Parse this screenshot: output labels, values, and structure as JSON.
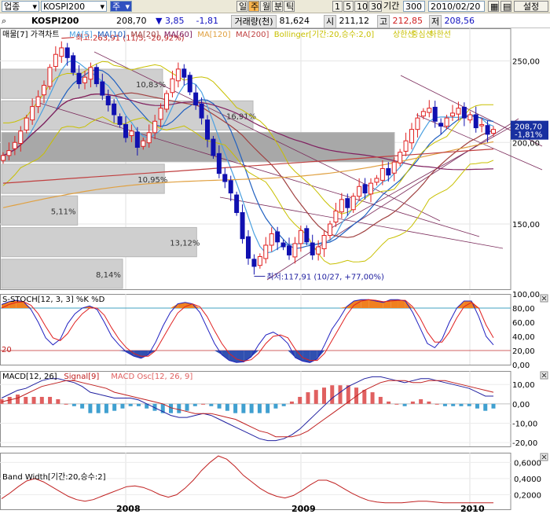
{
  "toolbar": {
    "market_select": "업종",
    "index_select": "KOSPI200",
    "period_select": "주",
    "period_buttons": [
      "일",
      "주",
      "월",
      "분",
      "틱"
    ],
    "num_buttons": [
      "1",
      "5",
      "10",
      "30"
    ],
    "count_label": "기간",
    "count_value": "300",
    "date_value": "2010/02/20",
    "settings_label": "설정"
  },
  "quote": {
    "name": "KOSPI200",
    "price": "208,70",
    "change_arrow": "▼",
    "change": "3,85",
    "change_pct": "-1,81",
    "volume_label": "거래량(천)",
    "volume": "81,624",
    "open_label": "시",
    "open": "211,12",
    "high_label": "고",
    "high": "212,85",
    "low_label": "저",
    "low": "208,56"
  },
  "colors": {
    "up": "#e02020",
    "down": "#1010b0",
    "ma5": "#4aa0e0",
    "ma10": "#2060c0",
    "ma20": "#a04040",
    "ma60": "#802060",
    "ma120": "#e0a040",
    "ma200": "#c04040",
    "bollinger": "#c8c000",
    "stoch_k": "#2020c0",
    "stoch_d": "#e02020",
    "macd": "#2020a0",
    "signal": "#c02020",
    "osc_pos": "#e06060",
    "osc_neg": "#40a0d0",
    "bandwidth": "#c02020",
    "price_tag_bg": "#1830a0"
  },
  "chart_data": [
    {
      "type": "line",
      "title": "매물[7] 가격차트",
      "legend": [
        "MA[5]",
        "MA[10]",
        "MA[20]",
        "MA[60]",
        "MA[120]",
        "MA[200]",
        "Bollinger[기간:20,승수:2,0]",
        "상한선",
        "중심선",
        "하한선"
      ],
      "ylim": [
        110,
        270
      ],
      "yticks": [
        "250,00",
        "200,00",
        "150,00"
      ],
      "ytick_values": [
        250,
        200,
        150
      ],
      "x_labels": [
        "2008",
        "2009",
        "2010"
      ],
      "current_price_tag": [
        "208,70",
        "-1,81%"
      ],
      "max_annotation": "최고:263,91 (11/5, -20,92%)",
      "min_annotation": "최저:117,91 (10/27, +77,00%)",
      "max_value": 263.91,
      "min_value": 117.91,
      "volume_profile": [
        {
          "label": "10,83%",
          "pct": 10.83
        },
        {
          "label": "16,91%",
          "pct": 16.91
        },
        {
          "label": "",
          "pct": 26.42
        },
        {
          "label": "10,95%",
          "pct": 10.95
        },
        {
          "label": "5,11%",
          "pct": 5.11
        },
        {
          "label": "13,12%",
          "pct": 13.12
        },
        {
          "label": "8,14%",
          "pct": 8.14
        }
      ],
      "weekly_close": [
        192,
        195,
        200,
        207,
        215,
        222,
        228,
        235,
        246,
        254,
        258,
        252,
        243,
        236,
        240,
        246,
        236,
        229,
        223,
        217,
        211,
        203,
        207,
        197,
        201,
        206,
        213,
        221,
        230,
        239,
        245,
        240,
        231,
        223,
        215,
        202,
        192,
        181,
        176,
        169,
        157,
        141,
        129,
        124,
        130,
        137,
        144,
        139,
        136,
        131,
        138,
        146,
        139,
        131,
        136,
        143,
        150,
        158,
        165,
        160,
        167,
        173,
        169,
        175,
        178,
        184,
        180,
        188,
        194,
        201,
        208,
        215,
        219,
        221,
        213,
        210,
        215,
        218,
        221,
        215,
        217,
        209,
        211,
        205,
        208
      ]
    },
    {
      "type": "line",
      "title": "S-STOCH[12, 3, 3] %K %D",
      "series": [
        {
          "name": "%K"
        },
        {
          "name": "%D"
        }
      ],
      "ylim": [
        0,
        100
      ],
      "yticks": [
        "100,00",
        "80,00",
        "60,00",
        "40,00",
        "20,00",
        "0,00"
      ],
      "ytick_values": [
        100,
        80,
        60,
        40,
        20,
        0
      ],
      "left_label": "20",
      "k_values": [
        85,
        89,
        91,
        89,
        78,
        60,
        38,
        28,
        36,
        58,
        72,
        80,
        83,
        78,
        60,
        40,
        28,
        18,
        12,
        9,
        14,
        32,
        55,
        74,
        86,
        88,
        86,
        74,
        52,
        30,
        14,
        6,
        3,
        4,
        11,
        28,
        42,
        46,
        40,
        30,
        10,
        5,
        3,
        8,
        28,
        50,
        65,
        82,
        90,
        92,
        92,
        90,
        88,
        92,
        92,
        90,
        74,
        52,
        30,
        24,
        36,
        60,
        80,
        90,
        90,
        68,
        40,
        28
      ],
      "d_values": [
        80,
        85,
        88,
        89,
        84,
        72,
        54,
        38,
        34,
        44,
        60,
        72,
        80,
        80,
        70,
        52,
        36,
        24,
        16,
        12,
        12,
        20,
        38,
        56,
        73,
        82,
        86,
        82,
        68,
        48,
        30,
        16,
        8,
        5,
        7,
        16,
        30,
        40,
        42,
        38,
        22,
        10,
        6,
        6,
        16,
        34,
        52,
        70,
        84,
        90,
        92,
        91,
        89,
        90,
        91,
        91,
        82,
        66,
        46,
        32,
        32,
        46,
        66,
        82,
        88,
        80,
        56,
        38
      ]
    },
    {
      "type": "line",
      "title": "MACD[12, 26]",
      "series": [
        {
          "name": "MACD[12, 26]"
        },
        {
          "name": "Signal[9]"
        },
        {
          "name": "MACD Osc[12, 26, 9]"
        }
      ],
      "ylim": [
        -22,
        17
      ],
      "yticks": [
        "10,00",
        "0,00",
        "-10,00",
        "-20,00"
      ],
      "ytick_values": [
        10,
        0,
        -10,
        -20
      ],
      "macd_values": [
        3,
        5,
        7,
        8,
        10,
        12,
        13,
        13,
        12,
        11,
        9,
        6,
        5,
        4,
        3,
        3,
        3,
        2,
        0,
        -2,
        -4,
        -6,
        -7,
        -7,
        -6,
        -5,
        -6,
        -8,
        -10,
        -12,
        -14,
        -16,
        -18,
        -19,
        -19,
        -18,
        -16,
        -13,
        -9,
        -5,
        -1,
        3,
        6,
        9,
        11,
        13,
        14,
        14,
        13,
        12,
        11,
        12,
        13,
        13,
        12,
        11,
        10,
        9,
        8,
        6,
        4,
        4
      ],
      "signal_values": [
        1,
        2,
        3,
        5,
        7,
        9,
        10,
        11,
        12,
        12,
        11,
        10,
        9,
        8,
        6,
        5,
        4,
        3,
        2,
        1,
        0,
        -2,
        -3,
        -4,
        -5,
        -5,
        -5,
        -6,
        -7,
        -8,
        -10,
        -12,
        -14,
        -15,
        -17,
        -17,
        -17,
        -16,
        -14,
        -11,
        -8,
        -5,
        -2,
        1,
        4,
        7,
        9,
        11,
        12,
        12,
        12,
        11,
        11,
        12,
        12,
        12,
        11,
        10,
        9,
        8,
        7,
        6
      ]
    },
    {
      "type": "line",
      "title": "Band Width[기간:20,승수:2]",
      "ylim": [
        0.02,
        0.72
      ],
      "yticks": [
        "0,6000",
        "0,4000",
        "0,2000"
      ],
      "ytick_values": [
        0.6,
        0.4,
        0.2
      ],
      "values": [
        0.15,
        0.22,
        0.3,
        0.37,
        0.4,
        0.36,
        0.3,
        0.24,
        0.18,
        0.14,
        0.12,
        0.14,
        0.18,
        0.22,
        0.26,
        0.3,
        0.31,
        0.29,
        0.25,
        0.2,
        0.17,
        0.2,
        0.28,
        0.38,
        0.5,
        0.6,
        0.68,
        0.64,
        0.55,
        0.44,
        0.36,
        0.28,
        0.22,
        0.18,
        0.16,
        0.19,
        0.25,
        0.32,
        0.38,
        0.38,
        0.34,
        0.28,
        0.22,
        0.17,
        0.13,
        0.11,
        0.1,
        0.1,
        0.1,
        0.11,
        0.12,
        0.12,
        0.11,
        0.1,
        0.1,
        0.1,
        0.1,
        0.1,
        0.1,
        0.1
      ]
    }
  ]
}
